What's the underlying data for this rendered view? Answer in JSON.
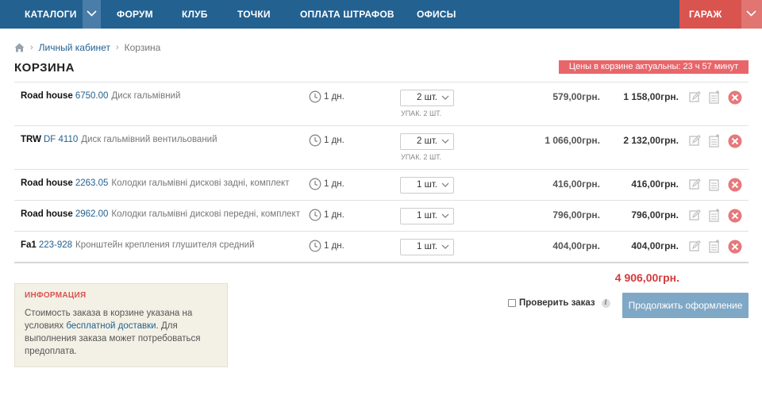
{
  "nav": {
    "items": [
      "КАТАЛОГИ",
      "ФОРУМ",
      "КЛУБ",
      "ТОЧКИ",
      "ОПЛАТА ШТРАФОВ",
      "ОФИСЫ"
    ],
    "garage": "ГАРАЖ"
  },
  "breadcrumb": {
    "items": [
      "Личный кабинет",
      "Корзина"
    ]
  },
  "page": {
    "title": "КОРЗИНА",
    "price_notice": "Цены в корзине актуальны: 23 ч 57 минут"
  },
  "cart": {
    "rows": [
      {
        "brand": "Road house",
        "code": "6750.00",
        "desc": "Диск гальмівний",
        "delivery": "1 дн.",
        "qty": "2 шт.",
        "pack": "УПАК. 2 ШТ.",
        "price": "579,00грн.",
        "sum": "1 158,00грн."
      },
      {
        "brand": "TRW",
        "code": "DF 4110",
        "desc": "Диск гальмівний вентильований",
        "delivery": "1 дн.",
        "qty": "2 шт.",
        "pack": "УПАК. 2 ШТ.",
        "price": "1 066,00грн.",
        "sum": "2 132,00грн."
      },
      {
        "brand": "Road house",
        "code": "2263.05",
        "desc": "Колодки гальмівні дискові задні, комплект",
        "delivery": "1 дн.",
        "qty": "1 шт.",
        "pack": "",
        "price": "416,00грн.",
        "sum": "416,00грн."
      },
      {
        "brand": "Road house",
        "code": "2962.00",
        "desc": "Колодки гальмівні дискові передні, комплект",
        "delivery": "1 дн.",
        "qty": "1 шт.",
        "pack": "",
        "price": "796,00грн.",
        "sum": "796,00грн."
      },
      {
        "brand": "Fa1",
        "code": "223-928",
        "desc": "Кронштейн крепления глушителя средний",
        "delivery": "1 дн.",
        "qty": "1 шт.",
        "pack": "",
        "price": "404,00грн.",
        "sum": "404,00грн."
      }
    ],
    "total": "4 906,00грн."
  },
  "info": {
    "title": "ИНФОРМАЦИЯ",
    "text_before": "Стоимость заказа в корзине указана на условиях ",
    "link": "бесплатной доставки",
    "text_after": ". Для выполнения заказа может потребоваться предоплата."
  },
  "checkout": {
    "check_label": "Проверить заказ",
    "info_icon": "i",
    "continue_label": "Продолжить оформление"
  },
  "colors": {
    "nav_bg": "#236191",
    "garage_bg": "#d9534f",
    "link": "#236191",
    "total": "#d43a3a",
    "button": "#7fa8c6"
  }
}
